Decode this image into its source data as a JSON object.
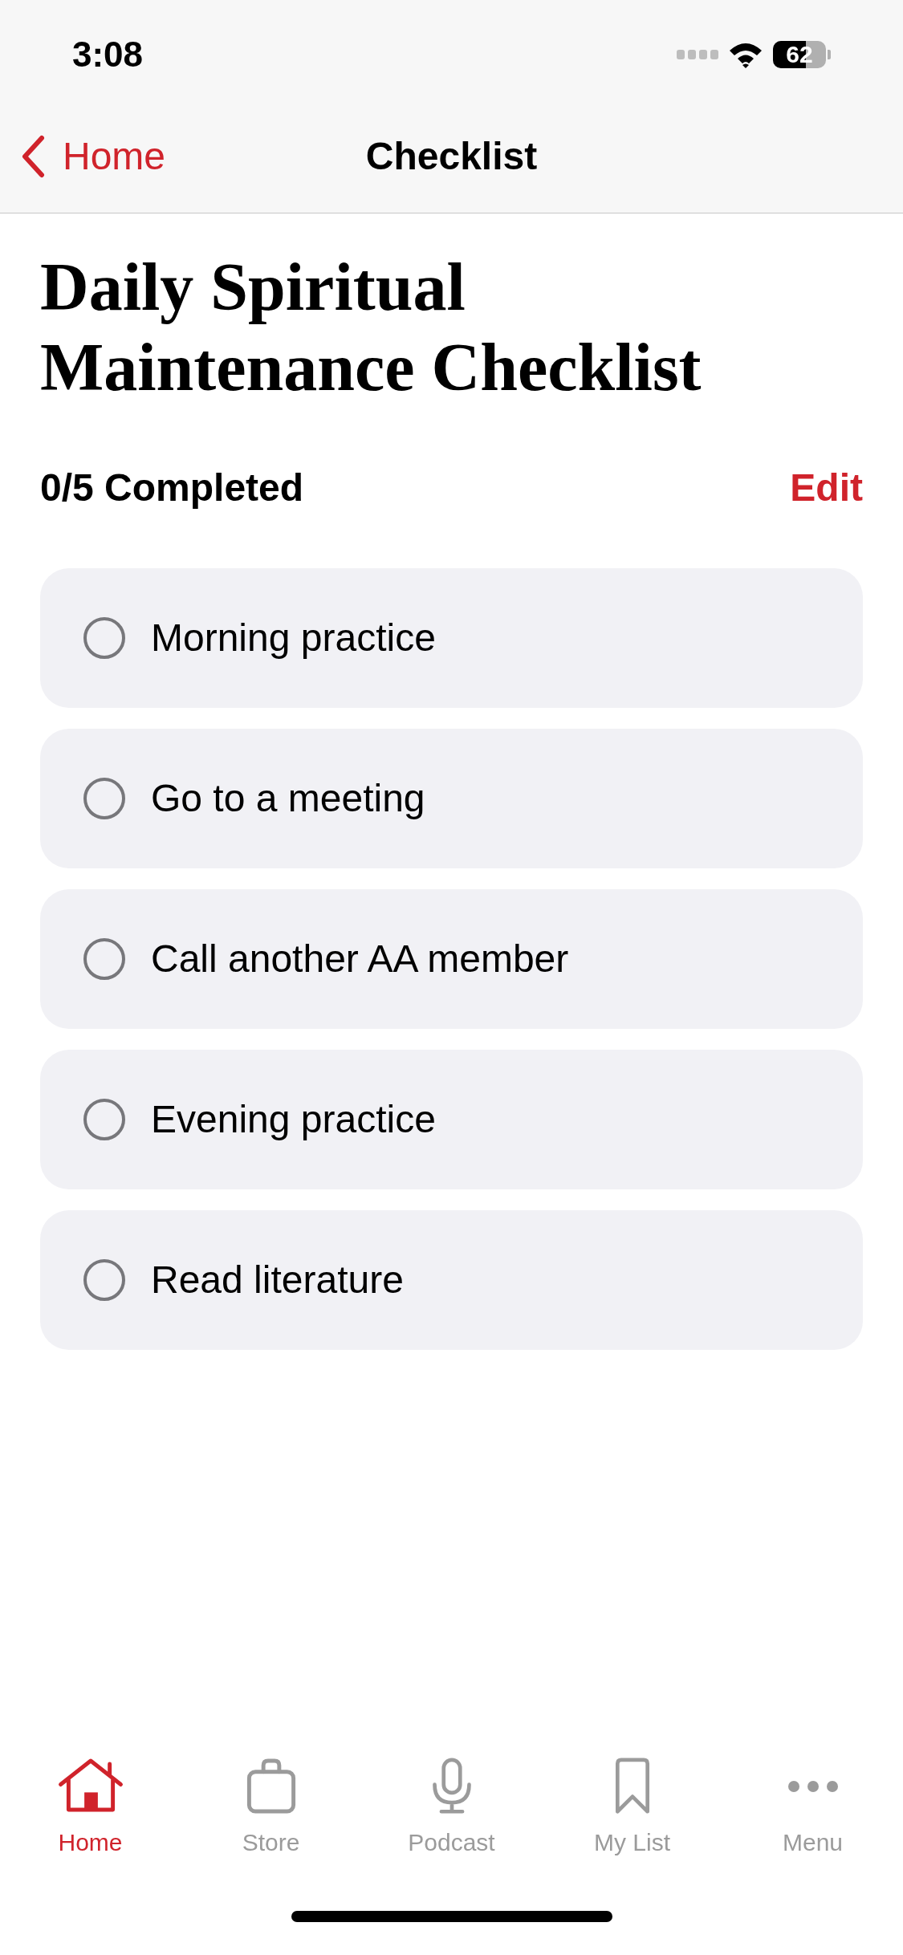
{
  "status_bar": {
    "time": "3:08",
    "battery": "62"
  },
  "nav": {
    "back": "Home",
    "title": "Checklist"
  },
  "heading": "Daily Spiritual Maintenance Checklist",
  "progress": "0/5 Completed",
  "edit": "Edit",
  "items": [
    {
      "label": "Morning practice",
      "checked": false
    },
    {
      "label": "Go to a meeting",
      "checked": false
    },
    {
      "label": "Call another AA member",
      "checked": false
    },
    {
      "label": "Evening practice",
      "checked": false
    },
    {
      "label": "Read literature",
      "checked": false
    }
  ],
  "tabs": [
    {
      "kind": "home",
      "label": "Home",
      "selected": true
    },
    {
      "kind": "store",
      "label": "Store",
      "selected": false
    },
    {
      "kind": "podcast",
      "label": "Podcast",
      "selected": false
    },
    {
      "kind": "list",
      "label": "My List",
      "selected": false
    },
    {
      "kind": "menu",
      "label": "Menu",
      "selected": false
    }
  ]
}
